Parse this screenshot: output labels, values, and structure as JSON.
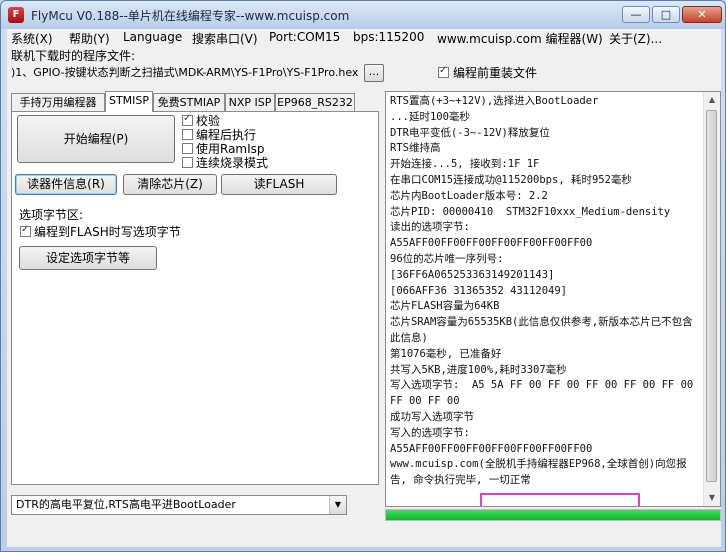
{
  "window": {
    "title": "FlyMcu V0.188--单片机在线编程专家--www.mcuisp.com",
    "min_label": "—",
    "max_label": "□",
    "close_label": "✕"
  },
  "menu": [
    "系统(X)",
    "帮助(Y)",
    "Language",
    "搜索串口(V)",
    "Port:COM15",
    "bps:115200",
    "www.mcuisp.com 编程器(W)",
    "关于(Z)..."
  ],
  "file": {
    "label": "联机下载时的程序文件:",
    "path": ")1、GPIO-按键状态判断之扫描式\\MDK-ARM\\YS-F1Pro\\YS-F1Pro.hex",
    "browse": "...",
    "reload_label": "编程前重装文件",
    "reload_checked": true
  },
  "tabs": [
    {
      "label": "手持万用编程器",
      "active": false
    },
    {
      "label": "STMISP",
      "active": true
    },
    {
      "label": "免费STMIAP",
      "active": false
    },
    {
      "label": "NXP ISP",
      "active": false
    },
    {
      "label": "EP968_RS232",
      "active": false
    }
  ],
  "stmisp": {
    "start_button": "开始编程(P)",
    "options": [
      {
        "label": "校验",
        "checked": true
      },
      {
        "label": "编程后执行",
        "checked": false
      },
      {
        "label": "使用RamIsp",
        "checked": false
      },
      {
        "label": "连续烧录模式",
        "checked": false
      }
    ],
    "read_info_button": "读器件信息(R)",
    "erase_button": "清除芯片(Z)",
    "read_flash_button": "读FLASH",
    "option_area_label": "选项字节区:",
    "write_option_label": "编程到FLASH时写选项字节",
    "write_option_checked": true,
    "set_option_button": "设定选项字节等"
  },
  "reset_mode": "DTR的高电平复位,RTS高电平进BootLoader",
  "log": [
    "RTS置高(+3~+12V),选择进入BootLoader",
    "...延时100毫秒",
    "DTR电平变低(-3~-12V)释放复位",
    "RTS维持高",
    "开始连接...5, 接收到:1F 1F",
    "在串口COM15连接成功@115200bps, 耗时952毫秒",
    "芯片内BootLoader版本号: 2.2",
    "芯片PID: 00000410  STM32F10xxx_Medium-density",
    "读出的选项字节:",
    "A55AFF00FF00FF00FF00FF00FF00FF00",
    "96位的芯片唯一序列号:",
    "[36FF6A065253363149201143]",
    "[066AFF36 31365352 43112049]",
    "芯片FLASH容量为64KB",
    "芯片SRAM容量为65535KB(此信息仅供参考,新版本芯片已不包含此信息)",
    "第1076毫秒, 已准备好",
    "共写入5KB,进度100%,耗时3307毫秒",
    "写入选项字节:  A5 5A FF 00 FF 00 FF 00 FF 00 FF 00 FF 00 FF 00",
    "成功写入选项字节",
    "写入的选项字节:",
    "A55AFF00FF00FF00FF00FF00FF00FF00",
    "www.mcuisp.com(全脱机手持编程器EP968,全球首创)向您报告, 命令执行完毕, 一切正常"
  ],
  "progress_fraction": 1.0,
  "colors": {
    "highlight": "#e53ad8",
    "progress": "#13b22f"
  }
}
